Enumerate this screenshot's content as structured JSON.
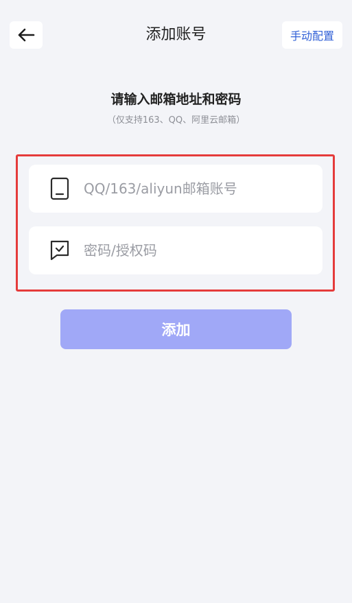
{
  "header": {
    "title": "添加账号",
    "manual_label": "手动配置",
    "back_icon": "arrow-left-icon"
  },
  "form": {
    "heading": "请输入邮箱地址和密码",
    "subheading": "（仅支持163、QQ、阿里云邮箱）",
    "email": {
      "icon": "phone-device-icon",
      "placeholder": "QQ/163/aliyun邮箱账号",
      "value": ""
    },
    "password": {
      "icon": "message-check-icon",
      "placeholder": "密码/授权码",
      "value": ""
    },
    "add_label": "添加"
  },
  "colors": {
    "background": "#f3f4f8",
    "accent_link": "#2f5fd6",
    "button_disabled": "#a0a8f7",
    "highlight_border": "#e53b3b"
  }
}
